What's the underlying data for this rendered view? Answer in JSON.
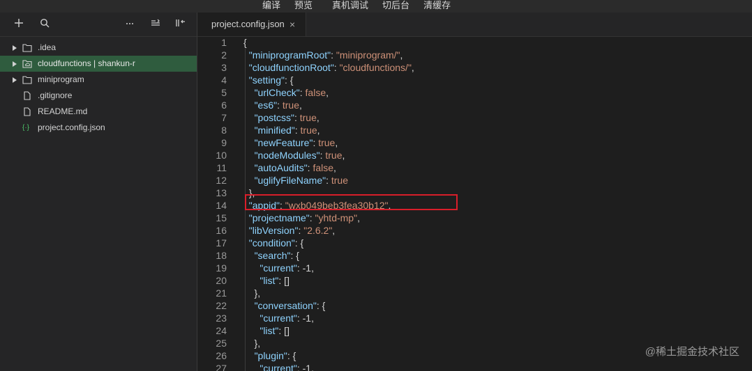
{
  "topbar": {
    "menu": [
      "编译",
      "预览",
      "真机调试",
      "切后台",
      "清缓存"
    ]
  },
  "sidebar": {
    "toolbar": {
      "add_icon": "plus-icon",
      "search_icon": "search-icon",
      "more_icon": "more-icon",
      "collapse_icon": "outline-icon",
      "split_icon": "split-back-icon"
    },
    "tree": [
      {
        "label": ".idea",
        "type": "folder",
        "expandable": true
      },
      {
        "label": "cloudfunctions | shankun-r",
        "type": "cloud-folder",
        "expandable": true,
        "active": true
      },
      {
        "label": "miniprogram",
        "type": "folder",
        "expandable": true
      },
      {
        "label": ".gitignore",
        "type": "file"
      },
      {
        "label": "README.md",
        "type": "file"
      },
      {
        "label": "project.config.json",
        "type": "json"
      }
    ]
  },
  "editor": {
    "tab": {
      "label": "project.config.json",
      "close": "×"
    },
    "line_numbers": [
      "1",
      "2",
      "3",
      "4",
      "5",
      "6",
      "7",
      "8",
      "9",
      "10",
      "11",
      "12",
      "13",
      "14",
      "15",
      "16",
      "17",
      "18",
      "19",
      "20",
      "21",
      "22",
      "23",
      "24",
      "25",
      "26",
      "27"
    ],
    "lines": [
      [
        {
          "t": "p",
          "v": "{"
        }
      ],
      [
        {
          "t": "p",
          "v": "  "
        },
        {
          "t": "k",
          "v": "\"miniprogramRoot\""
        },
        {
          "t": "p",
          "v": ": "
        },
        {
          "t": "s",
          "v": "\"miniprogram/\""
        },
        {
          "t": "p",
          "v": ","
        }
      ],
      [
        {
          "t": "p",
          "v": "  "
        },
        {
          "t": "k",
          "v": "\"cloudfunctionRoot\""
        },
        {
          "t": "p",
          "v": ": "
        },
        {
          "t": "s",
          "v": "\"cloudfunctions/\""
        },
        {
          "t": "p",
          "v": ","
        }
      ],
      [
        {
          "t": "p",
          "v": "  "
        },
        {
          "t": "k",
          "v": "\"setting\""
        },
        {
          "t": "p",
          "v": ": {"
        }
      ],
      [
        {
          "t": "p",
          "v": "    "
        },
        {
          "t": "k",
          "v": "\"urlCheck\""
        },
        {
          "t": "p",
          "v": ": "
        },
        {
          "t": "n",
          "v": "false"
        },
        {
          "t": "p",
          "v": ","
        }
      ],
      [
        {
          "t": "p",
          "v": "    "
        },
        {
          "t": "k",
          "v": "\"es6\""
        },
        {
          "t": "p",
          "v": ": "
        },
        {
          "t": "n",
          "v": "true"
        },
        {
          "t": "p",
          "v": ","
        }
      ],
      [
        {
          "t": "p",
          "v": "    "
        },
        {
          "t": "k",
          "v": "\"postcss\""
        },
        {
          "t": "p",
          "v": ": "
        },
        {
          "t": "n",
          "v": "true"
        },
        {
          "t": "p",
          "v": ","
        }
      ],
      [
        {
          "t": "p",
          "v": "    "
        },
        {
          "t": "k",
          "v": "\"minified\""
        },
        {
          "t": "p",
          "v": ": "
        },
        {
          "t": "n",
          "v": "true"
        },
        {
          "t": "p",
          "v": ","
        }
      ],
      [
        {
          "t": "p",
          "v": "    "
        },
        {
          "t": "k",
          "v": "\"newFeature\""
        },
        {
          "t": "p",
          "v": ": "
        },
        {
          "t": "n",
          "v": "true"
        },
        {
          "t": "p",
          "v": ","
        }
      ],
      [
        {
          "t": "p",
          "v": "    "
        },
        {
          "t": "k",
          "v": "\"nodeModules\""
        },
        {
          "t": "p",
          "v": ": "
        },
        {
          "t": "n",
          "v": "true"
        },
        {
          "t": "p",
          "v": ","
        }
      ],
      [
        {
          "t": "p",
          "v": "    "
        },
        {
          "t": "k",
          "v": "\"autoAudits\""
        },
        {
          "t": "p",
          "v": ": "
        },
        {
          "t": "n",
          "v": "false"
        },
        {
          "t": "p",
          "v": ","
        }
      ],
      [
        {
          "t": "p",
          "v": "    "
        },
        {
          "t": "k",
          "v": "\"uglifyFileName\""
        },
        {
          "t": "p",
          "v": ": "
        },
        {
          "t": "n",
          "v": "true"
        }
      ],
      [
        {
          "t": "p",
          "v": "  },"
        }
      ],
      [
        {
          "t": "p",
          "v": "  "
        },
        {
          "t": "k",
          "v": "\"appid\""
        },
        {
          "t": "p",
          "v": ": "
        },
        {
          "t": "s",
          "v": "\"wxb049beb3fea30b12\""
        },
        {
          "t": "p",
          "v": ","
        }
      ],
      [
        {
          "t": "p",
          "v": "  "
        },
        {
          "t": "k",
          "v": "\"projectname\""
        },
        {
          "t": "p",
          "v": ": "
        },
        {
          "t": "s",
          "v": "\"yhtd-mp\""
        },
        {
          "t": "p",
          "v": ","
        }
      ],
      [
        {
          "t": "p",
          "v": "  "
        },
        {
          "t": "k",
          "v": "\"libVersion\""
        },
        {
          "t": "p",
          "v": ": "
        },
        {
          "t": "s",
          "v": "\"2.6.2\""
        },
        {
          "t": "p",
          "v": ","
        }
      ],
      [
        {
          "t": "p",
          "v": "  "
        },
        {
          "t": "k",
          "v": "\"condition\""
        },
        {
          "t": "p",
          "v": ": {"
        }
      ],
      [
        {
          "t": "p",
          "v": "    "
        },
        {
          "t": "k",
          "v": "\"search\""
        },
        {
          "t": "p",
          "v": ": {"
        }
      ],
      [
        {
          "t": "p",
          "v": "      "
        },
        {
          "t": "k",
          "v": "\"current\""
        },
        {
          "t": "p",
          "v": ": -1,"
        }
      ],
      [
        {
          "t": "p",
          "v": "      "
        },
        {
          "t": "k",
          "v": "\"list\""
        },
        {
          "t": "p",
          "v": ": []"
        }
      ],
      [
        {
          "t": "p",
          "v": "    },"
        }
      ],
      [
        {
          "t": "p",
          "v": "    "
        },
        {
          "t": "k",
          "v": "\"conversation\""
        },
        {
          "t": "p",
          "v": ": {"
        }
      ],
      [
        {
          "t": "p",
          "v": "      "
        },
        {
          "t": "k",
          "v": "\"current\""
        },
        {
          "t": "p",
          "v": ": -1,"
        }
      ],
      [
        {
          "t": "p",
          "v": "      "
        },
        {
          "t": "k",
          "v": "\"list\""
        },
        {
          "t": "p",
          "v": ": []"
        }
      ],
      [
        {
          "t": "p",
          "v": "    },"
        }
      ],
      [
        {
          "t": "p",
          "v": "    "
        },
        {
          "t": "k",
          "v": "\"plugin\""
        },
        {
          "t": "p",
          "v": ": {"
        }
      ],
      [
        {
          "t": "p",
          "v": "      "
        },
        {
          "t": "k",
          "v": "\"current\""
        },
        {
          "t": "p",
          "v": ": -1,"
        }
      ]
    ],
    "highlight_line": 14
  },
  "watermark": "@稀土掘金技术社区"
}
